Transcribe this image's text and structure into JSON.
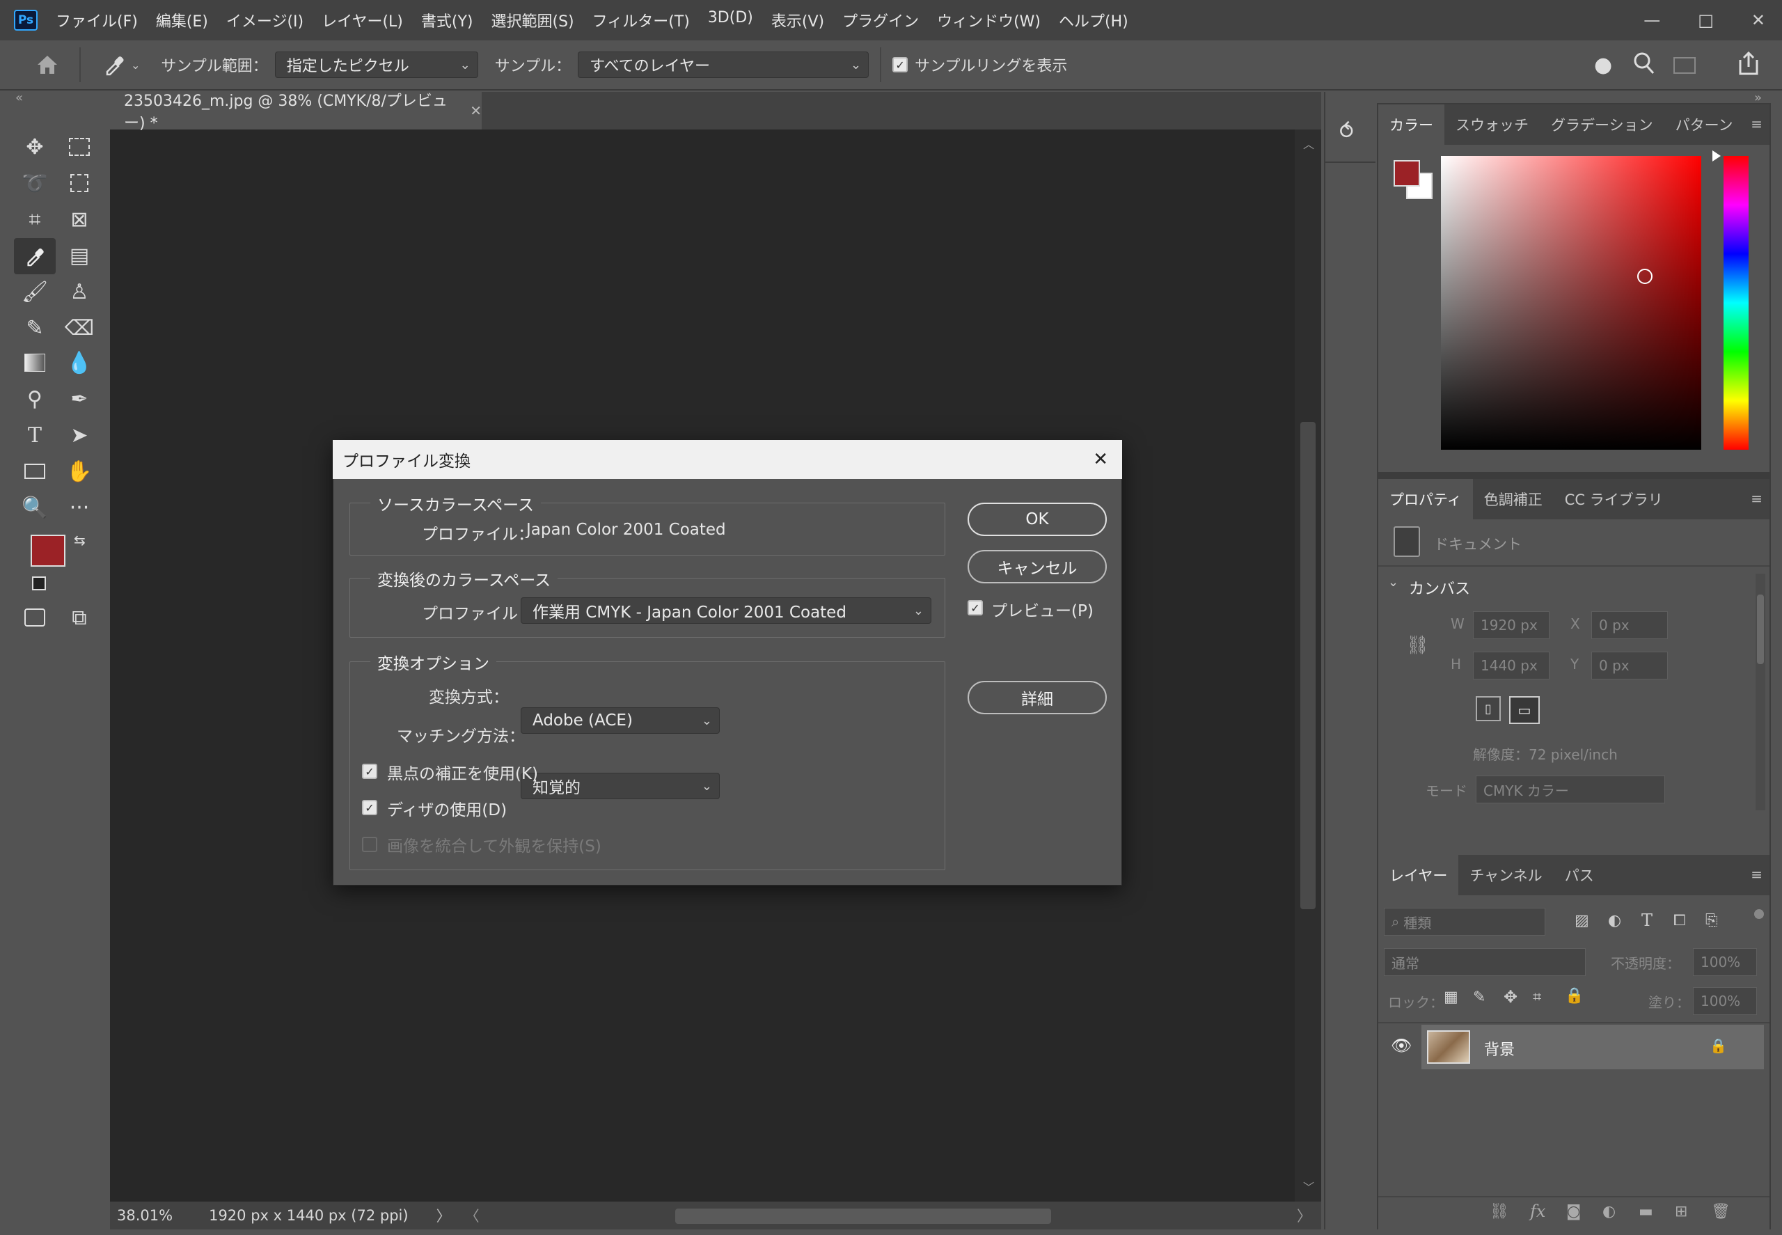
{
  "app": {
    "logo": "Ps"
  },
  "menu": [
    "ファイル(F)",
    "編集(E)",
    "イメージ(I)",
    "レイヤー(L)",
    "書式(Y)",
    "選択範囲(S)",
    "フィルター(T)",
    "3D(D)",
    "表示(V)",
    "プラグイン",
    "ウィンドウ(W)",
    "ヘルプ(H)"
  ],
  "window_buttons": {
    "minimize": "—",
    "maximize": "□",
    "close": "✕"
  },
  "options": {
    "sample_size_label": "サンプル範囲：",
    "sample_size_value": "指定したピクセル",
    "sample_label": "サンプル：",
    "sample_value": "すべてのレイヤー",
    "show_ring_label": "サンプルリングを表示",
    "show_ring_checked": true
  },
  "document": {
    "tab_title": "23503426_m.jpg @ 38% (CMYK/8/プレビュー) *",
    "zoom": "38.01%",
    "size_info": "1920 px x 1440 px (72 ppi)"
  },
  "colors": {
    "foreground": "#9b2226",
    "background": "#ffffff",
    "accent": "#31a8ff"
  },
  "color_panel": {
    "tabs": [
      "カラー",
      "スウォッチ",
      "グラデーション",
      "パターン"
    ],
    "active": 0
  },
  "properties_panel": {
    "tabs": [
      "プロパティ",
      "色調補正",
      "CC ライブラリ"
    ],
    "doc_label": "ドキュメント",
    "section": "カンバス",
    "w_label": "W",
    "w_value": "1920 px",
    "h_label": "H",
    "h_value": "1440 px",
    "x_label": "X",
    "x_value": "0 px",
    "y_label": "Y",
    "y_value": "0 px",
    "resolution": "解像度：72 pixel/inch",
    "mode_label": "モード",
    "mode_value": "CMYK カラー"
  },
  "layers_panel": {
    "tabs": [
      "レイヤー",
      "チャンネル",
      "パス"
    ],
    "filter_placeholder": "種類",
    "blend_mode": "通常",
    "opacity_label": "不透明度：",
    "opacity_value": "100%",
    "lock_label": "ロック：",
    "fill_label": "塗り：",
    "fill_value": "100%",
    "layers": [
      {
        "name": "背景"
      }
    ]
  },
  "dialog": {
    "title": "プロファイル変換",
    "source_group": "ソースカラースペース",
    "source_profile_label": "プロファイル：",
    "source_profile_value": "Japan Color 2001 Coated",
    "dest_group": "変換後のカラースペース",
    "dest_profile_label": "プロファイル：",
    "dest_profile_value": "作業用 CMYK - Japan Color 2001 Coated",
    "options_group": "変換オプション",
    "engine_label": "変換方式：",
    "engine_value": "Adobe (ACE)",
    "intent_label": "マッチング方法：",
    "intent_value": "知覚的",
    "bpc_label": "黒点の補正を使用(K)",
    "bpc_checked": true,
    "dither_label": "ディザの使用(D)",
    "dither_checked": true,
    "flatten_label": "画像を統合して外観を保持(S)",
    "flatten_checked": false,
    "ok_label": "OK",
    "cancel_label": "キャンセル",
    "preview_label": "プレビュー(P)",
    "preview_checked": true,
    "advanced_label": "詳細",
    "close_glyph": "✕"
  }
}
